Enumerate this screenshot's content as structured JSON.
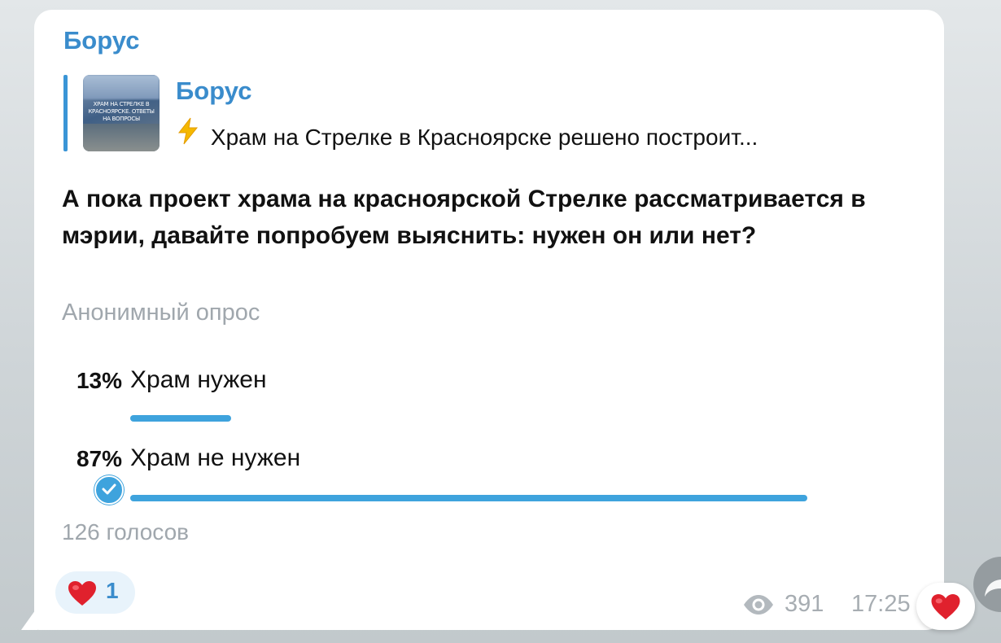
{
  "message": {
    "sender_name": "Борус",
    "reply": {
      "author": "Борус",
      "icon": "lightning-icon",
      "snippet": "Храм на Стрелке в Красноярске решено построит...",
      "thumbnail_caption": "ХРАМ НА СТРЕЛКЕ В КРАСНОЯРСКЕ. ОТВЕТЫ НА ВОПРОСЫ"
    },
    "poll": {
      "question": "А пока проект храма на красноярской Стрелке рассматривается в мэрии, давайте попробуем выяснить: нужен он или нет?",
      "type_label": "Анонимный опрос",
      "options": [
        {
          "percent_text": "13%",
          "label": "Храм нужен",
          "share": 0.13,
          "chosen": false
        },
        {
          "percent_text": "87%",
          "label": "Храм не нужен",
          "share": 0.87,
          "chosen": true
        }
      ],
      "total_votes": "126 голосов"
    },
    "reaction": {
      "emoji": "heart-icon",
      "count": "1"
    },
    "views": "391",
    "time": "17:25"
  },
  "colors": {
    "accent": "#3a8ccc",
    "bar": "#3ea3dd",
    "heart": "#e0212d",
    "muted": "#a0a7ad"
  }
}
